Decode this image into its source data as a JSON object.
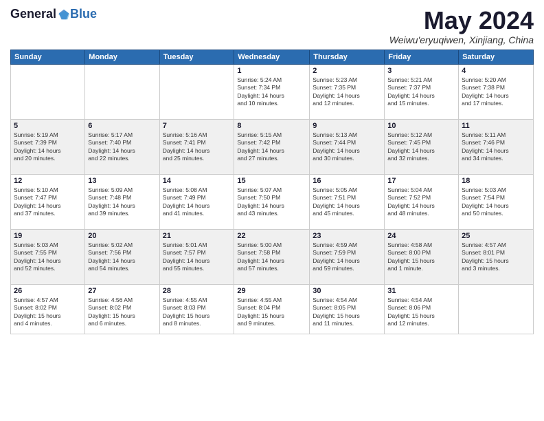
{
  "header": {
    "logo": {
      "general": "General",
      "blue": "Blue"
    },
    "title": "May 2024",
    "subtitle": "Weiwu'eryuqiwen, Xinjiang, China"
  },
  "calendar": {
    "weekdays": [
      "Sunday",
      "Monday",
      "Tuesday",
      "Wednesday",
      "Thursday",
      "Friday",
      "Saturday"
    ],
    "weeks": [
      [
        {
          "day": "",
          "info": ""
        },
        {
          "day": "",
          "info": ""
        },
        {
          "day": "",
          "info": ""
        },
        {
          "day": "1",
          "info": "Sunrise: 5:24 AM\nSunset: 7:34 PM\nDaylight: 14 hours\nand 10 minutes."
        },
        {
          "day": "2",
          "info": "Sunrise: 5:23 AM\nSunset: 7:35 PM\nDaylight: 14 hours\nand 12 minutes."
        },
        {
          "day": "3",
          "info": "Sunrise: 5:21 AM\nSunset: 7:37 PM\nDaylight: 14 hours\nand 15 minutes."
        },
        {
          "day": "4",
          "info": "Sunrise: 5:20 AM\nSunset: 7:38 PM\nDaylight: 14 hours\nand 17 minutes."
        }
      ],
      [
        {
          "day": "5",
          "info": "Sunrise: 5:19 AM\nSunset: 7:39 PM\nDaylight: 14 hours\nand 20 minutes."
        },
        {
          "day": "6",
          "info": "Sunrise: 5:17 AM\nSunset: 7:40 PM\nDaylight: 14 hours\nand 22 minutes."
        },
        {
          "day": "7",
          "info": "Sunrise: 5:16 AM\nSunset: 7:41 PM\nDaylight: 14 hours\nand 25 minutes."
        },
        {
          "day": "8",
          "info": "Sunrise: 5:15 AM\nSunset: 7:42 PM\nDaylight: 14 hours\nand 27 minutes."
        },
        {
          "day": "9",
          "info": "Sunrise: 5:13 AM\nSunset: 7:44 PM\nDaylight: 14 hours\nand 30 minutes."
        },
        {
          "day": "10",
          "info": "Sunrise: 5:12 AM\nSunset: 7:45 PM\nDaylight: 14 hours\nand 32 minutes."
        },
        {
          "day": "11",
          "info": "Sunrise: 5:11 AM\nSunset: 7:46 PM\nDaylight: 14 hours\nand 34 minutes."
        }
      ],
      [
        {
          "day": "12",
          "info": "Sunrise: 5:10 AM\nSunset: 7:47 PM\nDaylight: 14 hours\nand 37 minutes."
        },
        {
          "day": "13",
          "info": "Sunrise: 5:09 AM\nSunset: 7:48 PM\nDaylight: 14 hours\nand 39 minutes."
        },
        {
          "day": "14",
          "info": "Sunrise: 5:08 AM\nSunset: 7:49 PM\nDaylight: 14 hours\nand 41 minutes."
        },
        {
          "day": "15",
          "info": "Sunrise: 5:07 AM\nSunset: 7:50 PM\nDaylight: 14 hours\nand 43 minutes."
        },
        {
          "day": "16",
          "info": "Sunrise: 5:05 AM\nSunset: 7:51 PM\nDaylight: 14 hours\nand 45 minutes."
        },
        {
          "day": "17",
          "info": "Sunrise: 5:04 AM\nSunset: 7:52 PM\nDaylight: 14 hours\nand 48 minutes."
        },
        {
          "day": "18",
          "info": "Sunrise: 5:03 AM\nSunset: 7:54 PM\nDaylight: 14 hours\nand 50 minutes."
        }
      ],
      [
        {
          "day": "19",
          "info": "Sunrise: 5:03 AM\nSunset: 7:55 PM\nDaylight: 14 hours\nand 52 minutes."
        },
        {
          "day": "20",
          "info": "Sunrise: 5:02 AM\nSunset: 7:56 PM\nDaylight: 14 hours\nand 54 minutes."
        },
        {
          "day": "21",
          "info": "Sunrise: 5:01 AM\nSunset: 7:57 PM\nDaylight: 14 hours\nand 55 minutes."
        },
        {
          "day": "22",
          "info": "Sunrise: 5:00 AM\nSunset: 7:58 PM\nDaylight: 14 hours\nand 57 minutes."
        },
        {
          "day": "23",
          "info": "Sunrise: 4:59 AM\nSunset: 7:59 PM\nDaylight: 14 hours\nand 59 minutes."
        },
        {
          "day": "24",
          "info": "Sunrise: 4:58 AM\nSunset: 8:00 PM\nDaylight: 15 hours\nand 1 minute."
        },
        {
          "day": "25",
          "info": "Sunrise: 4:57 AM\nSunset: 8:01 PM\nDaylight: 15 hours\nand 3 minutes."
        }
      ],
      [
        {
          "day": "26",
          "info": "Sunrise: 4:57 AM\nSunset: 8:02 PM\nDaylight: 15 hours\nand 4 minutes."
        },
        {
          "day": "27",
          "info": "Sunrise: 4:56 AM\nSunset: 8:02 PM\nDaylight: 15 hours\nand 6 minutes."
        },
        {
          "day": "28",
          "info": "Sunrise: 4:55 AM\nSunset: 8:03 PM\nDaylight: 15 hours\nand 8 minutes."
        },
        {
          "day": "29",
          "info": "Sunrise: 4:55 AM\nSunset: 8:04 PM\nDaylight: 15 hours\nand 9 minutes."
        },
        {
          "day": "30",
          "info": "Sunrise: 4:54 AM\nSunset: 8:05 PM\nDaylight: 15 hours\nand 11 minutes."
        },
        {
          "day": "31",
          "info": "Sunrise: 4:54 AM\nSunset: 8:06 PM\nDaylight: 15 hours\nand 12 minutes."
        },
        {
          "day": "",
          "info": ""
        }
      ]
    ]
  }
}
